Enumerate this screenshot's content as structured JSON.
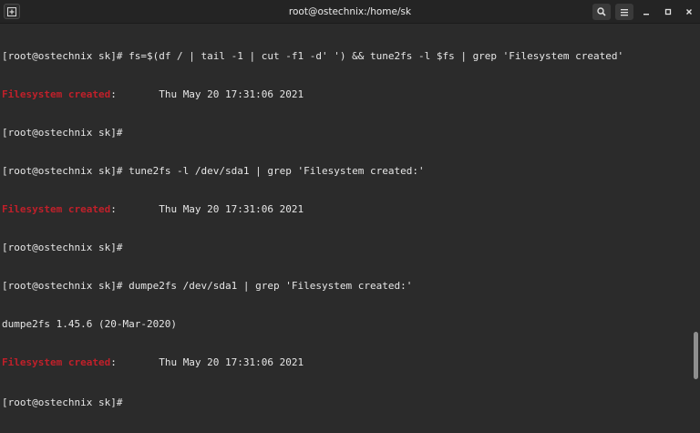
{
  "window": {
    "title": "root@ostechnix:/home/sk"
  },
  "icons": {
    "new_tab": "new-tab-icon",
    "search": "search-icon",
    "menu": "hamburger-menu-icon",
    "minimize": "minimize-icon",
    "maximize": "maximize-icon",
    "close": "close-icon"
  },
  "colors": {
    "highlight": "#c0202a",
    "background": "#2b2b2b",
    "titlebar": "#242424",
    "text": "#e6e6e6"
  },
  "terminal": {
    "prompt": "[root@ostechnix sk]# ",
    "match": "Filesystem created",
    "created_value": ":       Thu May 20 17:31:06 2021",
    "cmd1": "fs=$(df / | tail -1 | cut -f1 -d' ') && tune2fs -l $fs | grep 'Filesystem created'",
    "cmd2": "tune2fs -l /dev/sda1 | grep 'Filesystem created:'",
    "cmd3": "dumpe2fs /dev/sda1 | grep 'Filesystem created:'",
    "dumpe2fs_version": "dumpe2fs 1.45.6 (20-Mar-2020)"
  }
}
